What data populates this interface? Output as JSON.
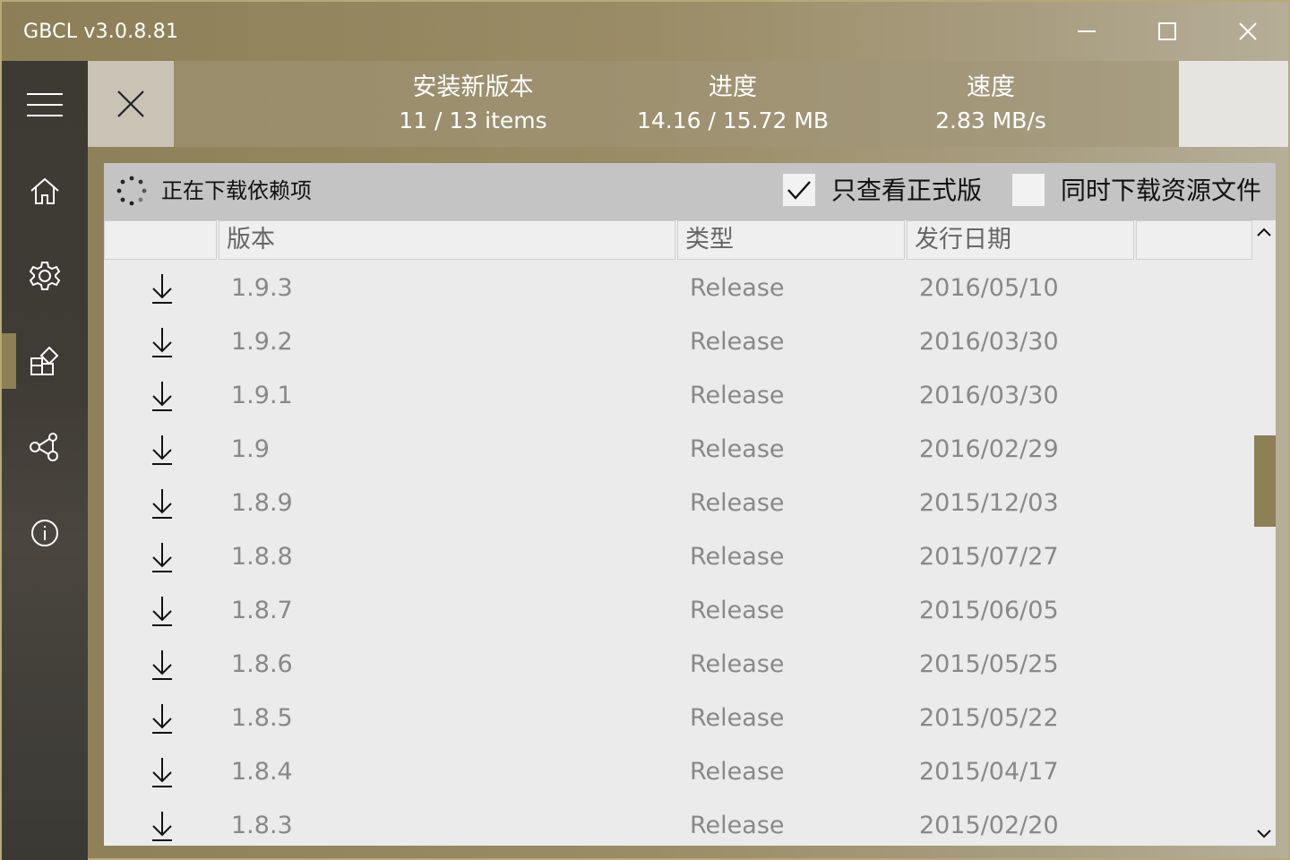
{
  "window": {
    "title": "GBCL v3.0.8.81",
    "minimize_icon": "minimize-icon",
    "maximize_icon": "maximize-icon",
    "close_icon": "close-icon"
  },
  "sidebar": {
    "items": [
      {
        "icon": "hamburger-menu-icon"
      },
      {
        "icon": "home-icon"
      },
      {
        "icon": "gear-icon"
      },
      {
        "icon": "download-store-icon",
        "active": true
      },
      {
        "icon": "share-nodes-icon"
      },
      {
        "icon": "info-icon"
      }
    ]
  },
  "progress": {
    "close_icon": "close-icon",
    "install_label": "安装新版本",
    "install_value": "11 / 13 items",
    "progress_label": "进度",
    "progress_value": "14.16 / 15.72 MB",
    "speed_label": "速度",
    "speed_value": "2.83 MB/s"
  },
  "panel": {
    "status_text": "正在下载依赖项",
    "release_only_label": "只查看正式版",
    "release_only_checked": true,
    "download_assets_label": "同时下载资源文件",
    "download_assets_checked": false,
    "columns": [
      "版本",
      "类型",
      "发行日期"
    ],
    "rows": [
      {
        "version": "1.9.3",
        "type": "Release",
        "date": "2016/05/10"
      },
      {
        "version": "1.9.2",
        "type": "Release",
        "date": "2016/03/30"
      },
      {
        "version": "1.9.1",
        "type": "Release",
        "date": "2016/03/30"
      },
      {
        "version": "1.9",
        "type": "Release",
        "date": "2016/02/29"
      },
      {
        "version": "1.8.9",
        "type": "Release",
        "date": "2015/12/03"
      },
      {
        "version": "1.8.8",
        "type": "Release",
        "date": "2015/07/27"
      },
      {
        "version": "1.8.7",
        "type": "Release",
        "date": "2015/06/05"
      },
      {
        "version": "1.8.6",
        "type": "Release",
        "date": "2015/05/25"
      },
      {
        "version": "1.8.5",
        "type": "Release",
        "date": "2015/05/22"
      },
      {
        "version": "1.8.4",
        "type": "Release",
        "date": "2015/04/17"
      },
      {
        "version": "1.8.3",
        "type": "Release",
        "date": "2015/02/20"
      }
    ]
  },
  "colors": {
    "accent": "#8d7f56",
    "sidebar_bg": "#3d3a33",
    "panel_bg": "#ebebeb",
    "panel_top_bg": "#c4c4c4"
  }
}
